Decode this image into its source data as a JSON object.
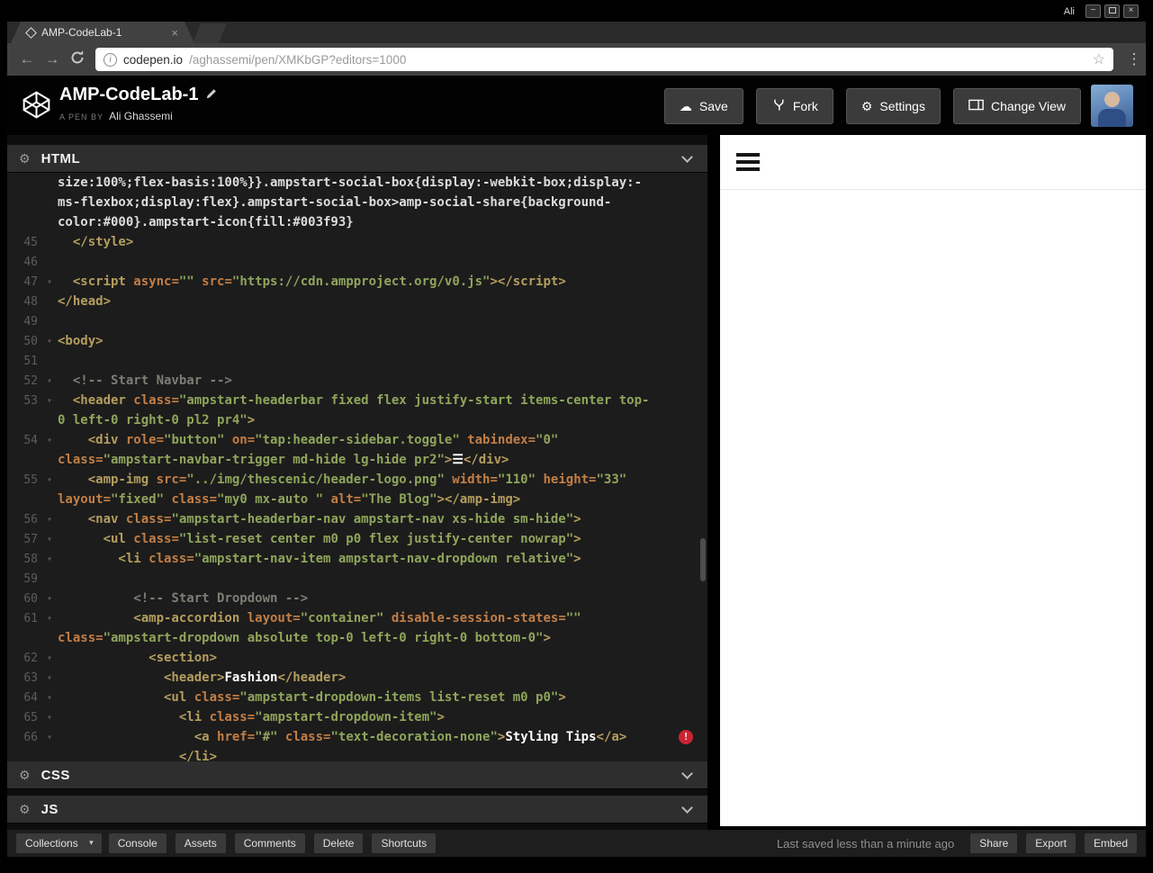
{
  "browser": {
    "session_user": "Ali",
    "tab_title": "AMP-CodeLab-1",
    "url_host": "codepen.io",
    "url_path": "/aghassemi/pen/XMKbGP?editors=1000"
  },
  "icons": {
    "gear": "⚙",
    "star": "☆",
    "dots": "⋮",
    "caret_down": "▾",
    "back": "←",
    "forward": "→",
    "cloud": "☁",
    "close": "×",
    "minimize": "−"
  },
  "header": {
    "title": "AMP-CodeLab-1",
    "byline_prefix": "A PEN BY",
    "author": "Ali Ghassemi",
    "buttons": {
      "save": "Save",
      "fork": "Fork",
      "settings": "Settings",
      "change_view": "Change View"
    }
  },
  "panels": {
    "html": "HTML",
    "css": "CSS",
    "js": "JS"
  },
  "colors": {
    "error_badge": "#cb2431",
    "editor_bg": "#1c1c1c",
    "tag": "#b49d5e",
    "attr": "#c27e45",
    "string": "#8fa55b",
    "comment": "#7d7d75"
  },
  "editor": {
    "rows": [
      {
        "no": "",
        "fold": false,
        "segs": [
          [
            "css",
            "size:100%;flex-basis:100%}}.ampstart-social-box{display:-webkit-box;display:-"
          ]
        ]
      },
      {
        "no": "",
        "fold": false,
        "segs": [
          [
            "css",
            "ms-flexbox;display:flex}.ampstart-social-box>amp-social-share{background-"
          ]
        ]
      },
      {
        "no": "",
        "fold": false,
        "segs": [
          [
            "css",
            "color:#000}.ampstart-icon{fill:#003f93}"
          ]
        ]
      },
      {
        "no": "45",
        "fold": false,
        "segs": [
          [
            "tag",
            "  </style>"
          ]
        ]
      },
      {
        "no": "46",
        "fold": false,
        "segs": []
      },
      {
        "no": "47",
        "fold": true,
        "segs": [
          [
            "tag",
            "  <script "
          ],
          [
            "attr",
            "async="
          ],
          [
            "str",
            "\"\""
          ],
          [
            "attr",
            " src="
          ],
          [
            "str",
            "\"https://cdn.ampproject.org/v0.js\""
          ],
          [
            "tag",
            "></script>"
          ]
        ]
      },
      {
        "no": "48",
        "fold": false,
        "segs": [
          [
            "tag",
            "</head>"
          ]
        ]
      },
      {
        "no": "49",
        "fold": false,
        "segs": []
      },
      {
        "no": "50",
        "fold": true,
        "segs": [
          [
            "tag",
            "<body>"
          ]
        ]
      },
      {
        "no": "51",
        "fold": false,
        "segs": []
      },
      {
        "no": "52",
        "fold": true,
        "segs": [
          [
            "com",
            "  <!-- Start Navbar -->"
          ]
        ]
      },
      {
        "no": "53",
        "fold": true,
        "segs": [
          [
            "tag",
            "  <header "
          ],
          [
            "attr",
            "class="
          ],
          [
            "str",
            "\"ampstart-headerbar fixed flex justify-start items-center top-"
          ]
        ]
      },
      {
        "no": "",
        "fold": false,
        "segs": [
          [
            "str",
            "0 left-0 right-0 pl2 pr4\""
          ],
          [
            "tag",
            ">"
          ]
        ]
      },
      {
        "no": "54",
        "fold": true,
        "segs": [
          [
            "tag",
            "    <div "
          ],
          [
            "attr",
            "role="
          ],
          [
            "str",
            "\"button\""
          ],
          [
            "attr",
            " on="
          ],
          [
            "str",
            "\"tap:header-sidebar.toggle\""
          ],
          [
            "attr",
            " tabindex="
          ],
          [
            "str",
            "\"0\""
          ]
        ]
      },
      {
        "no": "",
        "fold": false,
        "segs": [
          [
            "attr",
            "class="
          ],
          [
            "str",
            "\"ampstart-navbar-trigger md-hide lg-hide pr2\""
          ],
          [
            "tag",
            ">"
          ],
          [
            "txt",
            "☰"
          ],
          [
            "tag",
            "</div>"
          ]
        ]
      },
      {
        "no": "55",
        "fold": true,
        "segs": [
          [
            "tag",
            "    <amp-img "
          ],
          [
            "attr",
            "src="
          ],
          [
            "str",
            "\"../img/thescenic/header-logo.png\""
          ],
          [
            "attr",
            " width="
          ],
          [
            "str",
            "\"110\""
          ],
          [
            "attr",
            " height="
          ],
          [
            "str",
            "\"33\""
          ]
        ]
      },
      {
        "no": "",
        "fold": false,
        "segs": [
          [
            "attr",
            "layout="
          ],
          [
            "str",
            "\"fixed\""
          ],
          [
            "attr",
            " class="
          ],
          [
            "str",
            "\"my0 mx-auto \""
          ],
          [
            "attr",
            " alt="
          ],
          [
            "str",
            "\"The Blog\""
          ],
          [
            "tag",
            "></amp-img>"
          ]
        ]
      },
      {
        "no": "56",
        "fold": true,
        "segs": [
          [
            "tag",
            "    <nav "
          ],
          [
            "attr",
            "class="
          ],
          [
            "str",
            "\"ampstart-headerbar-nav ampstart-nav xs-hide sm-hide\""
          ],
          [
            "tag",
            ">"
          ]
        ]
      },
      {
        "no": "57",
        "fold": true,
        "segs": [
          [
            "tag",
            "      <ul "
          ],
          [
            "attr",
            "class="
          ],
          [
            "str",
            "\"list-reset center m0 p0 flex justify-center nowrap\""
          ],
          [
            "tag",
            ">"
          ]
        ]
      },
      {
        "no": "58",
        "fold": true,
        "segs": [
          [
            "tag",
            "        <li "
          ],
          [
            "attr",
            "class="
          ],
          [
            "str",
            "\"ampstart-nav-item ampstart-nav-dropdown relative\""
          ],
          [
            "tag",
            ">"
          ]
        ]
      },
      {
        "no": "59",
        "fold": false,
        "segs": []
      },
      {
        "no": "60",
        "fold": true,
        "segs": [
          [
            "com",
            "          <!-- Start Dropdown -->"
          ]
        ]
      },
      {
        "no": "61",
        "fold": true,
        "segs": [
          [
            "tag",
            "          <amp-accordion "
          ],
          [
            "attr",
            "layout="
          ],
          [
            "str",
            "\"container\""
          ],
          [
            "attr",
            " disable-session-states="
          ],
          [
            "str",
            "\"\""
          ]
        ]
      },
      {
        "no": "",
        "fold": false,
        "segs": [
          [
            "attr",
            "class="
          ],
          [
            "str",
            "\"ampstart-dropdown absolute top-0 left-0 right-0 bottom-0\""
          ],
          [
            "tag",
            ">"
          ]
        ]
      },
      {
        "no": "62",
        "fold": true,
        "segs": [
          [
            "tag",
            "            <section>"
          ]
        ]
      },
      {
        "no": "63",
        "fold": true,
        "segs": [
          [
            "tag",
            "              <header>"
          ],
          [
            "txt",
            "Fashion"
          ],
          [
            "tag",
            "</header>"
          ]
        ]
      },
      {
        "no": "64",
        "fold": true,
        "segs": [
          [
            "tag",
            "              <ul "
          ],
          [
            "attr",
            "class="
          ],
          [
            "str",
            "\"ampstart-dropdown-items list-reset m0 p0\""
          ],
          [
            "tag",
            ">"
          ]
        ]
      },
      {
        "no": "65",
        "fold": true,
        "segs": [
          [
            "tag",
            "                <li "
          ],
          [
            "attr",
            "class="
          ],
          [
            "str",
            "\"ampstart-dropdown-item\""
          ],
          [
            "tag",
            ">"
          ]
        ]
      },
      {
        "no": "66",
        "fold": true,
        "error": true,
        "segs": [
          [
            "tag",
            "                  <a "
          ],
          [
            "attr",
            "href="
          ],
          [
            "str",
            "\"#\""
          ],
          [
            "attr",
            " class="
          ],
          [
            "str",
            "\"text-decoration-none\""
          ],
          [
            "tag",
            ">"
          ],
          [
            "txt",
            "Styling Tips"
          ],
          [
            "tag",
            "</a>"
          ]
        ]
      },
      {
        "no": "",
        "fold": false,
        "segs": [
          [
            "tag",
            "                </li>"
          ]
        ]
      }
    ]
  },
  "footer": {
    "collections_label": "Collections",
    "buttons_left": [
      "Console",
      "Assets",
      "Comments",
      "Delete",
      "Shortcuts"
    ],
    "status": "Last saved less than a minute ago",
    "buttons_right": [
      "Share",
      "Export",
      "Embed"
    ]
  }
}
